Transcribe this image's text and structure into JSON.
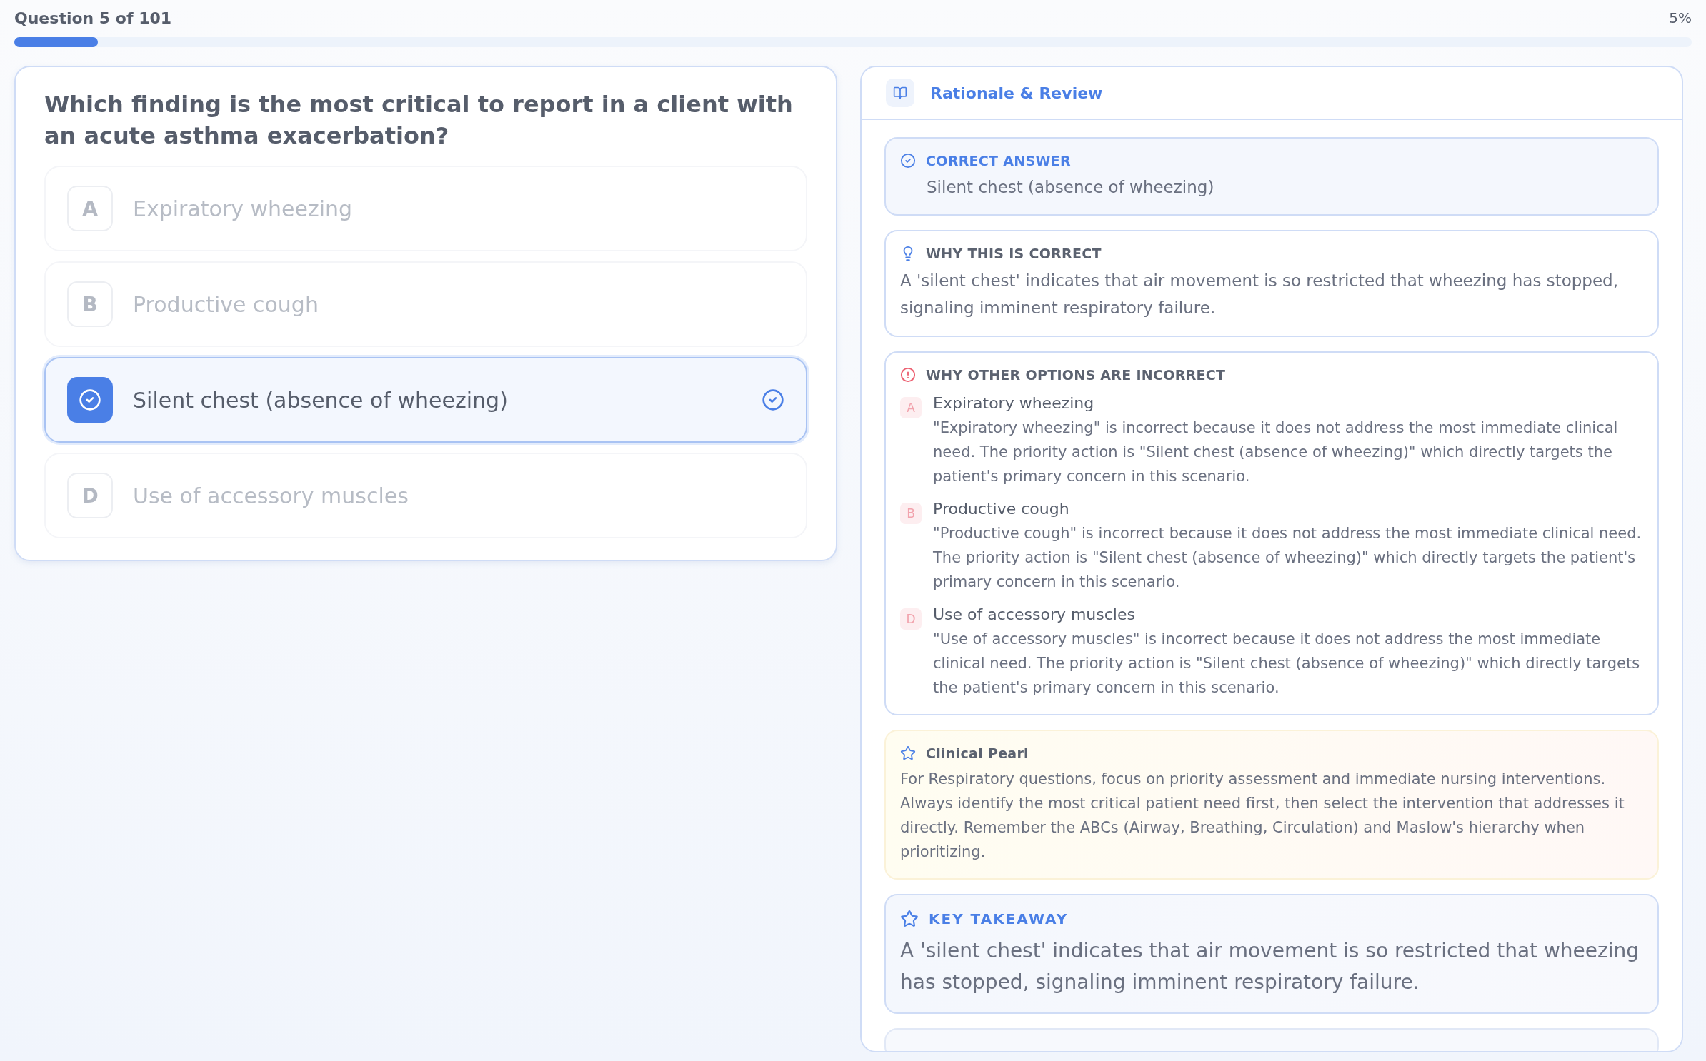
{
  "progress": {
    "label": "Question 5 of 101",
    "percent": "5%",
    "level": 0.05
  },
  "question": {
    "text": "Which finding is the most critical to report in a client with an acute asthma exacerbation?",
    "options": [
      {
        "letter": "A",
        "text": "Expiratory wheezing",
        "selected": false
      },
      {
        "letter": "B",
        "text": "Productive cough",
        "selected": false
      },
      {
        "text": "Silent chest (absence of wheezing)",
        "selected": true
      },
      {
        "letter": "D",
        "text": "Use of accessory muscles",
        "selected": false
      }
    ]
  },
  "rationale": {
    "title": "Rationale & Review",
    "correct_answer": {
      "label": "CORRECT ANSWER",
      "text": "Silent chest (absence of wheezing)"
    },
    "why_correct": {
      "label": "WHY THIS IS CORRECT",
      "text": "A 'silent chest' indicates that air movement is so restricted that wheezing has stopped, signaling imminent respiratory failure."
    },
    "why_incorrect": {
      "label": "WHY OTHER OPTIONS ARE INCORRECT",
      "items": [
        {
          "letter": "A",
          "title": "Expiratory wheezing",
          "text": "\"Expiratory wheezing\" is incorrect because it does not address the most immediate clinical need. The priority action is \"Silent chest (absence of wheezing)\" which directly targets the patient's primary concern in this scenario."
        },
        {
          "letter": "B",
          "title": "Productive cough",
          "text": "\"Productive cough\" is incorrect because it does not address the most immediate clinical need. The priority action is \"Silent chest (absence of wheezing)\" which directly targets the patient's primary concern in this scenario."
        },
        {
          "letter": "D",
          "title": "Use of accessory muscles",
          "text": "\"Use of accessory muscles\" is incorrect because it does not address the most immediate clinical need. The priority action is \"Silent chest (absence of wheezing)\" which directly targets the patient's primary concern in this scenario."
        }
      ]
    },
    "clinical_pearl": {
      "label": "Clinical Pearl",
      "text": "For Respiratory questions, focus on priority assessment and immediate nursing interventions. Always identify the most critical patient need first, then select the intervention that addresses it directly. Remember the ABCs (Airway, Breathing, Circulation) and Maslow's hierarchy when prioritizing."
    },
    "key_takeaway": {
      "label": "KEY TAKEAWAY",
      "text": "A 'silent chest' indicates that air movement is so restricted that wheezing has stopped, signaling imminent respiratory failure."
    }
  }
}
